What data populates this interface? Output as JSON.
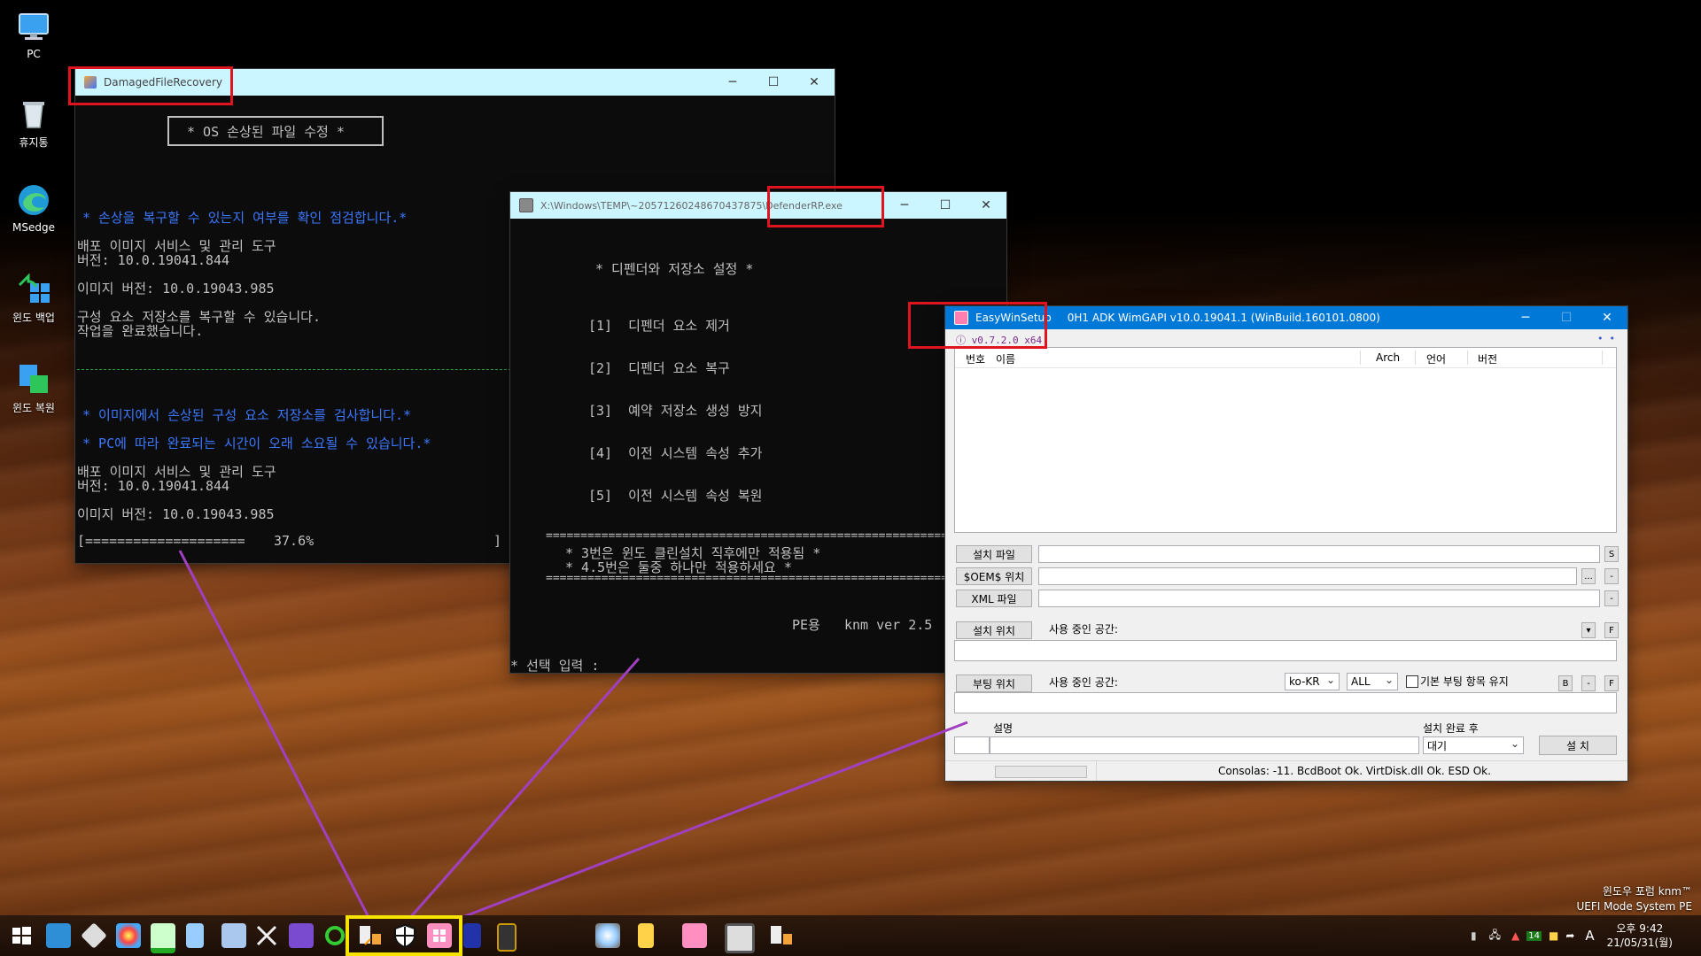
{
  "desktop": {
    "icons": [
      {
        "label": "PC",
        "icon": "computer-icon"
      },
      {
        "label": "휴지통",
        "icon": "recycle-bin-icon"
      },
      {
        "label": "MSedge",
        "icon": "edge-icon"
      },
      {
        "label": "윈도 백업",
        "icon": "backup-icon"
      },
      {
        "label": "윈도 복원",
        "icon": "restore-icon"
      }
    ],
    "watermark_line1": "윈도우 포럼 knm™",
    "watermark_line2": "UEFI Mode System PE"
  },
  "win1": {
    "title": "DamagedFileRecovery",
    "header": "* OS 손상된 파일 수정 *",
    "lines": [
      "* 손상을 복구할 수 있는지 여부를 확인 점검합니다.*",
      "배포 이미지 서비스 및 관리 도구",
      "버전: 10.0.19041.844",
      "이미지 버전: 10.0.19043.985",
      "구성 요소 저장소를 복구할 수 있습니다.",
      "작업을 완료했습니다.",
      "* 이미지에서 손상된 구성 요소 저장소를 검사합니다.*",
      "* PC에 따라 완료되는 시간이 오래 소요될 수 있습니다.*",
      "배포 이미지 서비스 및 관리 도구",
      "버전: 10.0.19041.844",
      "이미지 버전: 10.0.19043.985"
    ],
    "progress_bar": "[====================",
    "progress_pct": "37.6%",
    "progress_end": "]",
    "progress": 0.376
  },
  "win2": {
    "title": "X:\\Windows\\TEMP\\~20571260248670437875\\DefenderRP.exe",
    "header": "* 디펜더와 저장소 설정 *",
    "menu": [
      "[1]  디펜더 요소 제거",
      "[2]  디펜더 요소 복구",
      "[3]  예약 저장소 생성 방지",
      "[4]  이전 시스템 속성 추가",
      "[5]  이전 시스템 속성 복원"
    ],
    "rule": "==========================================================",
    "note1": "* 3번은 윈도 클린설치 직후에만 적용됨 *",
    "note2": "* 4.5번은 둘중 하나만 적용하세요 *",
    "footer": "PE용   knm ver 2.5",
    "prompt": "* 선택 입력 :"
  },
  "win3": {
    "title": "EasyWinSetup",
    "title_info": "0H1 ADK   WimGAPI v10.0.19041.1 (WinBuild.160101.0800)",
    "version": "v0.7.2.0 x64",
    "columns": [
      "번호",
      "이름",
      "Arch",
      "언어",
      "버전"
    ],
    "btn_install_file": "설치 파일",
    "btn_oem": "$OEM$ 위치",
    "btn_xml": "XML 파일",
    "btn_install_loc": "설치 위치",
    "btn_boot_loc": "부팅 위치",
    "used_space1": "사용 중인 공간:",
    "used_space2": "사용 중인 공간:",
    "lang_select": "ko-KR",
    "all_select": "ALL",
    "keep_boot": "기본 부팅 항목 유지",
    "desc_label": "설명",
    "after_label": "설치 완료 후",
    "after_select": "대기",
    "install_btn": "설 치",
    "sq_s": "S",
    "sq_dots": "...",
    "sq_dash": "-",
    "sq_f": "F",
    "sq_b": "B",
    "status": "Consolas: -11. BcdBoot Ok. VirtDisk.dll Ok. ESD Ok."
  },
  "taskbar": {
    "start": "start-icon",
    "clock_time": "오후 9:42",
    "clock_date": "21/05/31(월)",
    "ime": "A",
    "badge": "14"
  },
  "colors": {
    "console_bg": "#0c0c0c",
    "console_fg": "#c0c0c0",
    "console_blue": "#3b78ff",
    "title_active": "#0078d7",
    "title_cyan": "#ccf6ff",
    "marker_red": "#e0141e",
    "marker_yellow": "#f7e300",
    "arrow_purple": "#a040c0"
  }
}
